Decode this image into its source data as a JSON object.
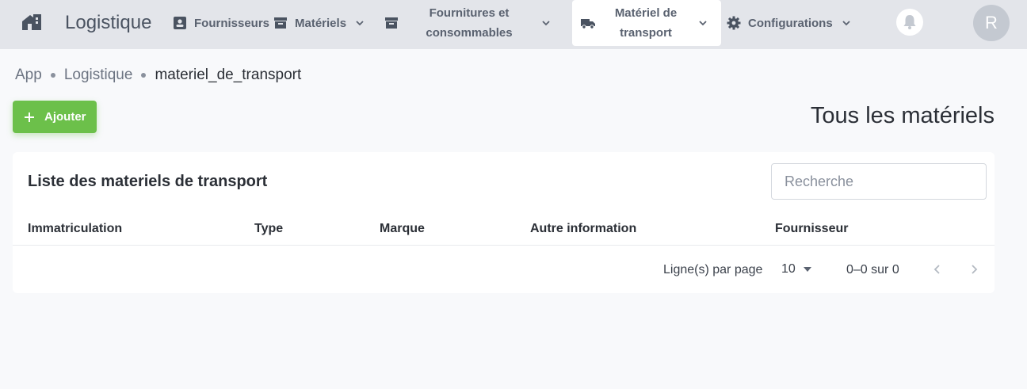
{
  "header": {
    "app_title": "Logistique",
    "nav": [
      {
        "label": "Fournisseurs",
        "icon": "contact-card-icon"
      },
      {
        "label": "Matériels",
        "icon": "archive-box-icon"
      },
      {
        "label": "Fournitures et consommables",
        "icon": "archive-box-icon"
      },
      {
        "label": "Matériel de transport",
        "icon": "truck-icon",
        "active": true
      },
      {
        "label": "Configurations",
        "icon": "gear-icon"
      }
    ],
    "avatar_initial": "R"
  },
  "breadcrumb": [
    "App",
    "Logistique",
    "materiel_de_transport"
  ],
  "actions": {
    "add_label": "Ajouter"
  },
  "page_title": "Tous les matériels",
  "card": {
    "title": "Liste des materiels de transport",
    "search_placeholder": "Recherche",
    "columns": [
      "Immatriculation",
      "Type",
      "Marque",
      "Autre information",
      "Fournisseur"
    ],
    "rows": [],
    "pagination": {
      "rows_per_page_label": "Ligne(s) par page",
      "rows_per_page": "10",
      "range": "0–0 sur 0"
    }
  },
  "colors": {
    "topbar": "#e3e5ea",
    "accent_green": "#6cc04a",
    "background": "#f8f9fb"
  }
}
